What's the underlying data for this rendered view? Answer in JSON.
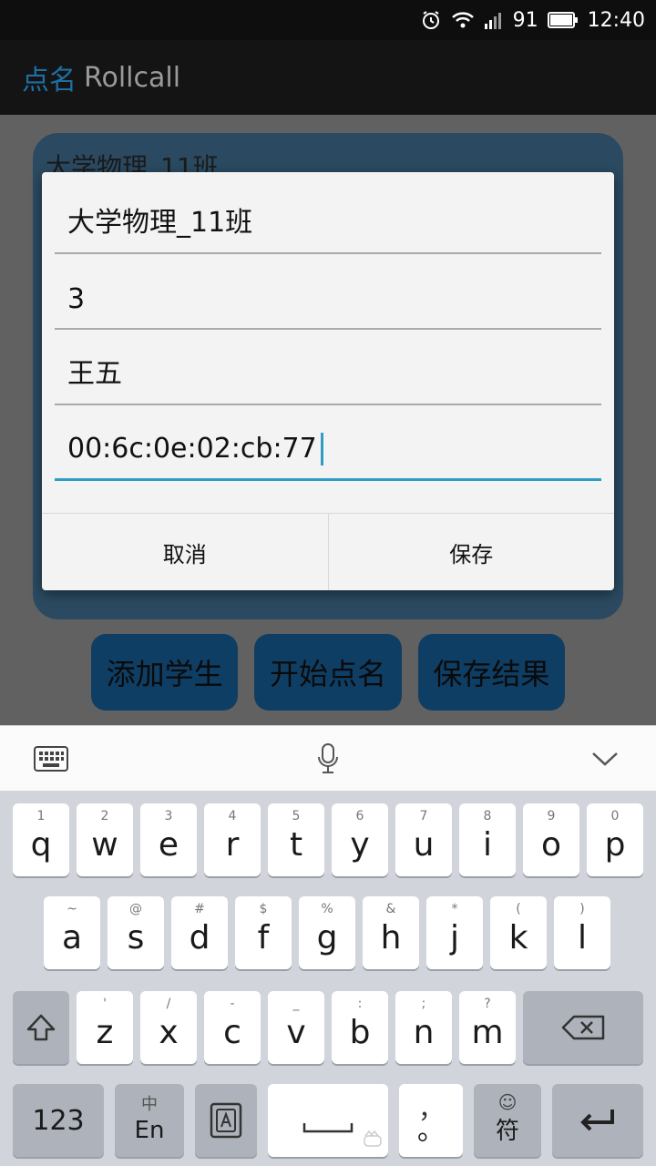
{
  "status_bar": {
    "battery": "91",
    "time": "12:40"
  },
  "app_bar": {
    "title_cn": "点名",
    "title_en": "Rollcall"
  },
  "background": {
    "class_title": "大学物理_11班",
    "buttons": [
      "添加学生",
      "开始点名",
      "保存结果"
    ]
  },
  "dialog": {
    "fields": [
      {
        "value": "大学物理_11班"
      },
      {
        "value": "3"
      },
      {
        "value": "王五"
      },
      {
        "value": "00:6c:0e:02:cb:77"
      }
    ],
    "cancel_label": "取消",
    "save_label": "保存"
  },
  "keyboard": {
    "row1": [
      {
        "main": "q",
        "hint": "1"
      },
      {
        "main": "w",
        "hint": "2"
      },
      {
        "main": "e",
        "hint": "3"
      },
      {
        "main": "r",
        "hint": "4"
      },
      {
        "main": "t",
        "hint": "5"
      },
      {
        "main": "y",
        "hint": "6"
      },
      {
        "main": "u",
        "hint": "7"
      },
      {
        "main": "i",
        "hint": "8"
      },
      {
        "main": "o",
        "hint": "9"
      },
      {
        "main": "p",
        "hint": "0"
      }
    ],
    "row2": [
      {
        "main": "a",
        "hint": "~"
      },
      {
        "main": "s",
        "hint": "@"
      },
      {
        "main": "d",
        "hint": "#"
      },
      {
        "main": "f",
        "hint": "$"
      },
      {
        "main": "g",
        "hint": "%"
      },
      {
        "main": "h",
        "hint": "&"
      },
      {
        "main": "j",
        "hint": "*"
      },
      {
        "main": "k",
        "hint": "("
      },
      {
        "main": "l",
        "hint": ")"
      }
    ],
    "row3": [
      {
        "main": "z",
        "hint": "'"
      },
      {
        "main": "x",
        "hint": "/"
      },
      {
        "main": "c",
        "hint": "-"
      },
      {
        "main": "v",
        "hint": "_"
      },
      {
        "main": "b",
        "hint": ":"
      },
      {
        "main": "n",
        "hint": ";"
      },
      {
        "main": "m",
        "hint": "?"
      }
    ],
    "num_key": "123",
    "lang_key_top": "中",
    "lang_key_bottom": "En",
    "punct_key_top": "，",
    "punct_key_bottom": "。",
    "symbol_key_bottom": "符",
    "symbol_key_top": "☺"
  }
}
